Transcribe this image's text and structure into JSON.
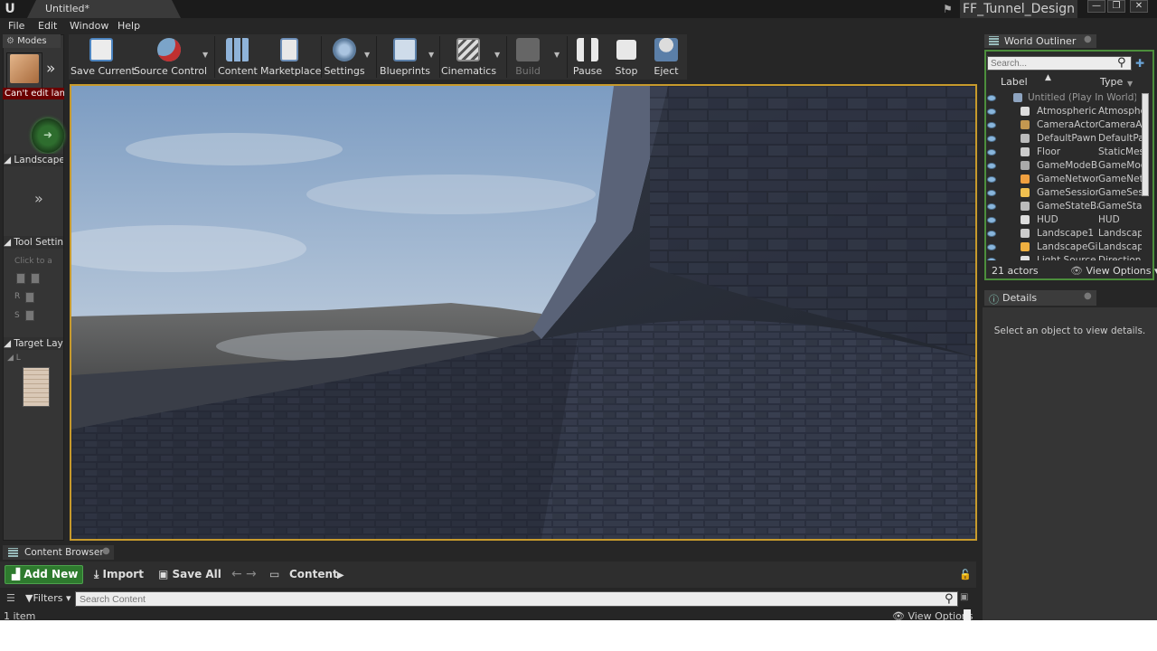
{
  "window": {
    "doc_tab": "Untitled*",
    "project_name": "FF_Tunnel_Design",
    "min_label": "—",
    "max_label": "❐",
    "close_label": "✕"
  },
  "menu": [
    "File",
    "Edit",
    "Window",
    "Help"
  ],
  "modes": {
    "tab_label": "Modes",
    "cant_edit": "Can't edit landscape",
    "section_landscape": "Landscape",
    "section_tool_settings": "Tool Settings",
    "section_target_layers": "Target Layers",
    "click_hint": "Click to a",
    "row_r": "R",
    "row_s": "S",
    "layer_l": "L"
  },
  "toolbar": [
    {
      "label": "Save Current",
      "icon": "save-icon"
    },
    {
      "label": "Source Control",
      "icon": "source-control-icon"
    },
    {
      "label": "Content",
      "icon": "content-icon"
    },
    {
      "label": "Marketplace",
      "icon": "marketplace-icon"
    },
    {
      "label": "Settings",
      "icon": "settings-icon"
    },
    {
      "label": "Blueprints",
      "icon": "blueprints-icon"
    },
    {
      "label": "Cinematics",
      "icon": "cinematics-icon"
    },
    {
      "label": "Build",
      "icon": "build-icon"
    },
    {
      "label": "Pause",
      "icon": "pause-icon"
    },
    {
      "label": "Stop",
      "icon": "stop-icon"
    },
    {
      "label": "Eject",
      "icon": "eject-icon"
    }
  ],
  "outliner": {
    "tab_label": "World Outliner",
    "search_placeholder": "Search...",
    "col_label": "Label",
    "col_type": "Type",
    "rows": [
      {
        "name": "Untitled (Play In World)",
        "type": ""
      },
      {
        "name": "Atmospheric F",
        "type": "Atmosphe"
      },
      {
        "name": "CameraActor",
        "type": "CameraA"
      },
      {
        "name": "DefaultPawn",
        "type": "DefaultPa"
      },
      {
        "name": "Floor",
        "type": "StaticMes"
      },
      {
        "name": "GameModeBa",
        "type": "GameMod"
      },
      {
        "name": "GameNetwork",
        "type": "GameNetw"
      },
      {
        "name": "GameSession",
        "type": "GameSes"
      },
      {
        "name": "GameStateBas",
        "type": "GameStat"
      },
      {
        "name": "HUD",
        "type": "HUD"
      },
      {
        "name": "Landscape1",
        "type": "Landscap"
      },
      {
        "name": "LandscapeGiz",
        "type": "Landscap"
      },
      {
        "name": "Light Source",
        "type": "Direction"
      }
    ],
    "actor_count": "21 actors",
    "view_options": "View Options"
  },
  "details": {
    "tab_label": "Details",
    "empty_message": "Select an object to view details."
  },
  "content_browser": {
    "tab_label": "Content Browser",
    "add_new": "Add New",
    "import": "Import",
    "save_all": "Save All",
    "path": "Content",
    "filters": "Filters",
    "search_placeholder": "Search Content",
    "item_count": "1 item",
    "view_options": "View Options"
  },
  "colors": {
    "viewport_border": "#c79a2c",
    "add_new_green": "#2e7a2e",
    "outliner_border": "#4c8e3c",
    "error_red": "#6b0000"
  }
}
